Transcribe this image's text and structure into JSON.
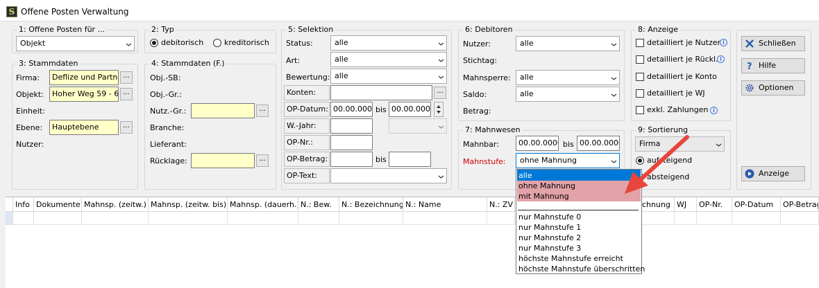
{
  "window": {
    "title": "Offene Posten Verwaltung",
    "icon": "app-s-icon"
  },
  "g1": {
    "legend": "1: Offene Posten für ...",
    "value": "Objekt"
  },
  "g2": {
    "legend": "2: Typ",
    "opt1": "debitorisch",
    "opt2": "kreditorisch",
    "selected": "debitorisch"
  },
  "g3": {
    "legend": "3: Stammdaten",
    "firma_label": "Firma:",
    "firma_value": "Deflize und Partne",
    "objekt_label": "Objekt:",
    "objekt_value": "Hoher Weg 59 - 6",
    "einheit_label": "Einheit:",
    "ebene_label": "Ebene:",
    "ebene_value": "Hauptebene",
    "nutzer_label": "Nutzer:"
  },
  "g4": {
    "legend": "4: Stammdaten (F.)",
    "objsb": "Obj.-SB:",
    "objgr": "Obj.-Gr.:",
    "nutzgr": "Nutz.-Gr.:",
    "branche": "Branche:",
    "lieferant": "Lieferant:",
    "ruecklage": "Rücklage:"
  },
  "g5": {
    "legend": "5: Selektion",
    "status_label": "Status:",
    "status_value": "alle",
    "art_label": "Art:",
    "art_value": "alle",
    "bew_label": "Bewertung:",
    "bew_value": "alle",
    "konten_label": "Konten:",
    "opdatum_label": "OP-Datum:",
    "opdatum_from": "00.00.0000",
    "bis1": "bis",
    "opdatum_to": "00.00.0000",
    "wjahr_label": "W.-Jahr:",
    "opnr_label": "OP-Nr.:",
    "opbetrag_label": "OP-Betrag:",
    "bis2": "bis",
    "optext_label": "OP-Text:"
  },
  "g6": {
    "legend": "6: Debitoren",
    "nutzer_label": "Nutzer:",
    "nutzer_value": "alle",
    "stichtag_label": "Stichtag:",
    "mahnsperre_label": "Mahnsperre:",
    "mahnsperre_value": "alle",
    "saldo_label": "Saldo:",
    "saldo_value": "alle",
    "betrag_label": "Betrag:"
  },
  "g7": {
    "legend": "7: Mahnwesen",
    "mahnbar_label": "Mahnbar:",
    "mahnbar_from": "00.00.0000",
    "bis": "bis",
    "mahnbar_to": "00.00.0000",
    "mahnstufe_label": "Mahnstufe:",
    "mahnstufe_value": "ohne Mahnung"
  },
  "g8": {
    "legend": "8: Anzeige",
    "cb1": "detailliert je Nutzer",
    "cb2": "detailliert je Rückl.",
    "cb3": "detailliert je Konto",
    "cb4": "detailliert je WJ",
    "cb5": "exkl. Zahlungen"
  },
  "g9": {
    "legend": "9: Sortierung",
    "value": "Firma",
    "opt1": "aufsteigend",
    "opt2": "absteigend",
    "selected": "aufsteigend"
  },
  "buttons": {
    "close": "Schließen",
    "help": "Hilfe",
    "options": "Optionen",
    "show": "Anzeige"
  },
  "grid": {
    "columns": [
      "Info",
      "Dokumente",
      "Mahnsp. (zeitw.)",
      "Mahnsp. (zeitw. bis)",
      "Mahnsp. (dauerh.)",
      "N.: Bew.",
      "N.: Bezeichnung",
      "N.: Name",
      "N.: ZV",
      "chnung",
      "WJ",
      "OP-Nr.",
      "OP-Datum",
      "OP-Betrag"
    ]
  },
  "dropdown": {
    "items": [
      "alle",
      "ohne Mahnung",
      "mit Mahnung",
      "nur Mahnstufe 0",
      "nur Mahnstufe 1",
      "nur Mahnstufe 2",
      "nur Mahnstufe 3",
      "höchste Mahnstufe erreicht",
      "höchste Mahnstufe überschritten"
    ],
    "selected": "alle",
    "highlighted": [
      "ohne Mahnung",
      "mit Mahnung"
    ]
  },
  "colors": {
    "selection": "#0078d7",
    "highlight": "#e2a3a8",
    "arrow": "#e8453c",
    "input_yellow": "#ffffc8",
    "required_label": "#d00000"
  }
}
